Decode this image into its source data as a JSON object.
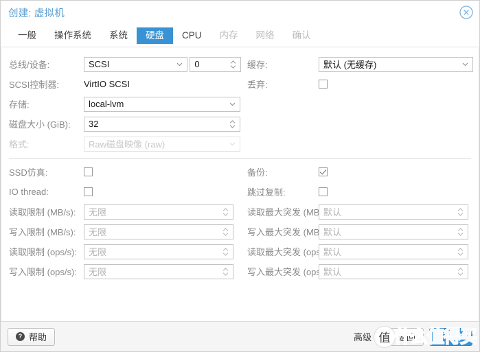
{
  "window": {
    "title": "创建: 虚拟机",
    "close_icon": "close-circle-icon"
  },
  "tabs": [
    {
      "label": "一般",
      "state": "done"
    },
    {
      "label": "操作系统",
      "state": "done"
    },
    {
      "label": "系统",
      "state": "done"
    },
    {
      "label": "硬盘",
      "state": "active"
    },
    {
      "label": "CPU",
      "state": "done"
    },
    {
      "label": "内存",
      "state": "disabled"
    },
    {
      "label": "网络",
      "state": "disabled"
    },
    {
      "label": "确认",
      "state": "disabled"
    }
  ],
  "form": {
    "left": {
      "bus_device": {
        "label": "总线/设备:",
        "bus_value": "SCSI",
        "index_value": "0"
      },
      "scsi_controller": {
        "label": "SCSI控制器:",
        "value": "VirtIO SCSI"
      },
      "storage": {
        "label": "存储:",
        "value": "local-lvm"
      },
      "disk_size": {
        "label": "磁盘大小 (GiB):",
        "value": "32"
      },
      "format": {
        "label": "格式:",
        "value": "Raw磁盘映像 (raw)",
        "disabled": true
      }
    },
    "right": {
      "cache": {
        "label": "缓存:",
        "value": "默认 (无缓存)"
      },
      "discard": {
        "label": "丢弃:",
        "checked": false
      }
    },
    "options_left": [
      {
        "label": "SSD仿真:",
        "checked": false
      },
      {
        "label": "IO thread:",
        "checked": false
      }
    ],
    "options_right": [
      {
        "label": "备份:",
        "checked": true
      },
      {
        "label": "跳过复制:",
        "checked": false
      }
    ],
    "limits_left": [
      {
        "label": "读取限制 (MB/s):",
        "placeholder": "无限"
      },
      {
        "label": "写入限制 (MB/s):",
        "placeholder": "无限"
      },
      {
        "label": "读取限制 (ops/s):",
        "placeholder": "无限"
      },
      {
        "label": "写入限制 (ops/s):",
        "placeholder": "无限"
      }
    ],
    "limits_right": [
      {
        "label": "读取最大突发 (MB):",
        "placeholder": "默认"
      },
      {
        "label": "写入最大突发 (MB):",
        "placeholder": "默认"
      },
      {
        "label": "读取最大突发 (ops):",
        "placeholder": "默认"
      },
      {
        "label": "写入最大突发 (ops):",
        "placeholder": "默认"
      }
    ]
  },
  "footer": {
    "help_label": "帮助",
    "help_icon": "question-mark-icon",
    "advanced_label": "高级",
    "advanced_checked": false,
    "back_label": "返回",
    "next_label": "下一个"
  },
  "watermark": {
    "badge_text": "值",
    "text": "什么值得买"
  },
  "colors": {
    "accent": "#3892d4",
    "title": "#5a9fd4",
    "label": "#8a8a8a",
    "placeholder": "#b4b4b4",
    "disabled": "#c8c8c8"
  }
}
